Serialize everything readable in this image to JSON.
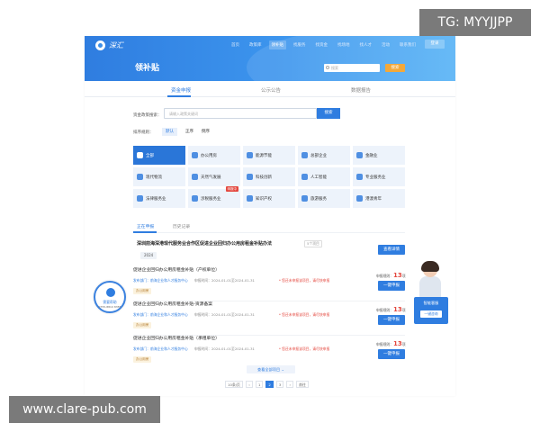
{
  "watermarks": {
    "top_right": "TG: MYYJJPP",
    "bottom_left": "www.clare-pub.com"
  },
  "header": {
    "logo_text": "深汇",
    "nav": [
      "首页",
      "政策库",
      "领补贴",
      "找服务",
      "找资金",
      "找场地",
      "找人才",
      "活动",
      "联系我们"
    ],
    "active_nav_index": 2,
    "action_button": "登录",
    "title": "领补贴",
    "search_placeholder": "搜索",
    "search_button": "搜索"
  },
  "tabs": [
    {
      "label": "资金申报",
      "active": true
    },
    {
      "label": "公示公告",
      "active": false
    },
    {
      "label": "数据报告",
      "active": false
    }
  ],
  "policy_search": {
    "label": "资金政策搜索：",
    "placeholder": "请输入政策关键词",
    "button": "搜索"
  },
  "sort": {
    "label": "排序规则：",
    "options": [
      {
        "label": "默认",
        "active": true
      },
      {
        "label": "正序",
        "active": false
      },
      {
        "label": "倒序",
        "active": false
      }
    ]
  },
  "categories": [
    {
      "label": "全部",
      "active": true,
      "badge": ""
    },
    {
      "label": "办公用房",
      "active": false,
      "badge": ""
    },
    {
      "label": "能源节能",
      "active": false,
      "badge": ""
    },
    {
      "label": "总部企业",
      "active": false,
      "badge": ""
    },
    {
      "label": "金融业",
      "active": false,
      "badge": ""
    },
    {
      "label": "现代物流",
      "active": false,
      "badge": ""
    },
    {
      "label": "天然气发展",
      "active": false,
      "badge": ""
    },
    {
      "label": "科技创新",
      "active": false,
      "badge": ""
    },
    {
      "label": "人工智能",
      "active": false,
      "badge": ""
    },
    {
      "label": "专业服务业",
      "active": false,
      "badge": ""
    },
    {
      "label": "法律服务业",
      "active": false,
      "badge": ""
    },
    {
      "label": "涉税服务业",
      "active": false,
      "badge": "申报中"
    },
    {
      "label": "知识产权",
      "active": false,
      "badge": ""
    },
    {
      "label": "旅游服务",
      "active": false,
      "badge": ""
    },
    {
      "label": "港澳青年",
      "active": false,
      "badge": ""
    }
  ],
  "sub_tabs": [
    {
      "label": "正在申报",
      "active": true
    },
    {
      "label": "历史记录",
      "active": false
    }
  ],
  "featured": {
    "title": "深圳前海深港现代服务业合作区促进企业回归办公用房租金补贴办法",
    "tag": "5个项目",
    "year": "2024",
    "button": "查看详情"
  },
  "items": [
    {
      "title": "促进企业回归办公用房租金补贴（产权单位）",
      "publisher": "发布部门：前海企业和人才服务中心",
      "date": "申报时间：2024-01-01至2024-01-31",
      "warning": "* 您还未申报该项目，请尽快申报",
      "tag": "办公用房",
      "count_label": "申报规则：",
      "count": "13",
      "count_unit": "项",
      "button": "一键申报"
    },
    {
      "title": "促进企业回归办公用房租金补贴-资源备案",
      "publisher": "发布部门：前海企业和人才服务中心",
      "date": "申报时间：2024-01-01至2024-01-31",
      "warning": "* 您还未申报该项目，请尽快申报",
      "tag": "办公用房",
      "count_label": "申报规则：",
      "count": "13",
      "count_unit": "项",
      "button": "一键申报"
    },
    {
      "title": "促进企业回归办公用房租金补贴（承租单位）",
      "publisher": "发布部门：前海企业和人才服务中心",
      "date": "申报时间：2024-01-01至2024-01-31",
      "warning": "* 您还未申报该项目，请尽快申报",
      "tag": "办公用房",
      "count_label": "申报规则：",
      "count": "13",
      "count_unit": "项",
      "button": "一键申报"
    }
  ],
  "more_button": "查看全部项目 ⌄",
  "pagination": {
    "page_size": "10条/页",
    "prev": "‹",
    "pages": [
      "1",
      "2",
      "3"
    ],
    "active_page": "2",
    "next": "›",
    "goto": "前往"
  },
  "float_left": {
    "title": "需要帮助",
    "phone": "0755-8810 8355"
  },
  "float_right": {
    "title": "智能客服",
    "button": "一键咨询"
  }
}
